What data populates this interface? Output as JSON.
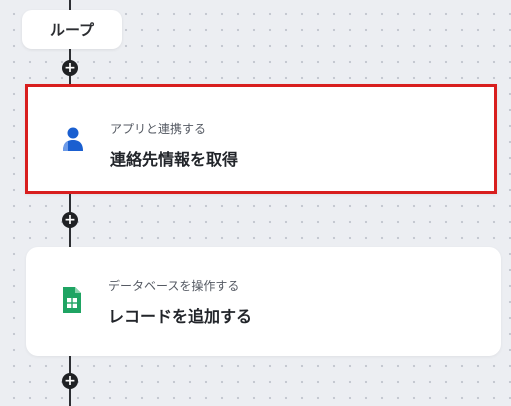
{
  "loop": {
    "label": "ループ"
  },
  "steps": [
    {
      "category": "アプリと連携する",
      "title": "連絡先情報を取得",
      "icon": "contact-person-icon",
      "selected": true,
      "color": "#1a5fd0"
    },
    {
      "category": "データベースを操作する",
      "title": "レコードを追加する",
      "icon": "spreadsheet-icon",
      "selected": false,
      "color": "#1fa463"
    }
  ],
  "connector": {
    "add_symbol": "+"
  },
  "colors": {
    "selection_border": "#d81e1e",
    "canvas": "#eceef2",
    "connector": "#2d2f33"
  }
}
